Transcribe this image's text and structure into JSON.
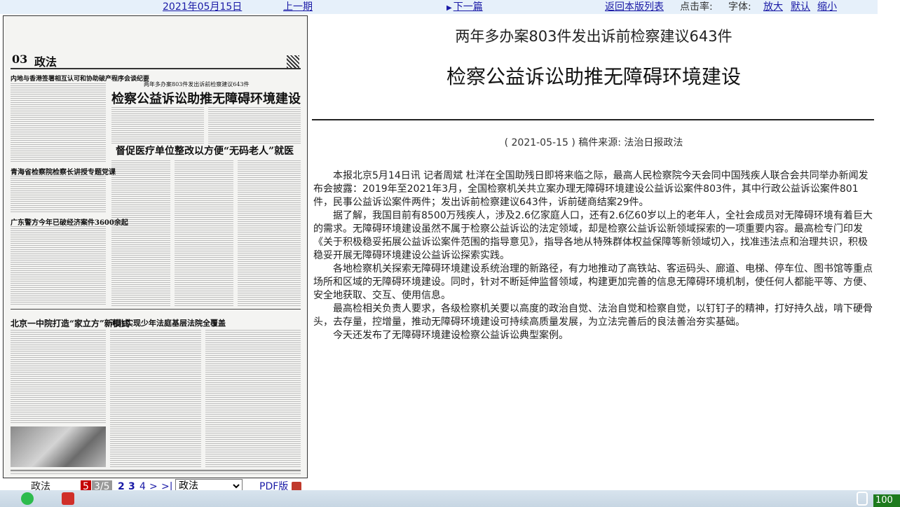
{
  "topbar": {
    "date": "2021年05月15日",
    "prev": "上一期",
    "next": "下一篇",
    "back": "返回本版列表",
    "clicks_label": "点击率:",
    "font_label": "字体:",
    "font_large": "放大",
    "font_default": "默认",
    "font_small": "缩小"
  },
  "paper": {
    "page_no": "03",
    "section": "政法",
    "headlines": [
      "两年多办案803件发出诉前检察建议643件",
      "检察公益诉讼助推无障碍环境建设",
      "督促医疗单位整改以方便“无码老人”就医",
      "内地与香港签署相互认可和协助破产程序会谈纪要",
      "青海省检察院检察长讲授专题党课",
      "广东警方今年已破经济案件3600余起",
      "北京一中院打造“家立方”新模式",
      "河北实现少年法庭基层法院全覆盖"
    ]
  },
  "article": {
    "subtitle": "两年多办案803件发出诉前检察建议643件",
    "title": "检察公益诉讼助推无障碍环境建设",
    "meta": "( 2021-05-15 )  稿件来源:  法治日报政法",
    "paragraphs": [
      "本报北京5月14日讯 记者周斌 杜洋在全国助残日即将来临之际，最高人民检察院今天会同中国残疾人联合会共同举办新闻发布会披露：2019年至2021年3月，全国检察机关共立案办理无障碍环境建设公益诉讼案件803件，其中行政公益诉讼案件801件，民事公益诉讼案件两件；发出诉前检察建议643件，诉前磋商结案29件。",
      "据了解，我国目前有8500万残疾人，涉及2.6亿家庭人口，还有2.6亿60岁以上的老年人，全社会成员对无障碍环境有着巨大的需求。无障碍环境建设虽然不属于检察公益诉讼的法定领域，却是检察公益诉讼新领域探索的一项重要内容。最高检专门印发《关于积极稳妥拓展公益诉讼案件范围的指导意见》，指导各地从特殊群体权益保障等新领域切入，找准违法点和治理共识，积极稳妥开展无障碍环境建设公益诉讼探索实践。",
      "各地检察机关探索无障碍环境建设系统治理的新路径，有力地推动了高铁站、客运码头、廊道、电梯、停车位、图书馆等重点场所和区域的无障碍环境建设。同时，针对不断延伸监督领域，构建更加完善的信息无障碍环境机制，使任何人都能平等、方便、安全地获取、交互、使用信息。",
      "最高检相关负责人要求，各级检察机关要以高度的政治自觉、法治自觉和检察自觉，以钉钉子的精神，打好持久战，啃下硬骨头，去存量，控增量，推动无障碍环境建设可持续高质量发展，为立法完善后的良法善治夯实基础。",
      "今天还发布了无障碍环境建设检察公益诉讼典型案例。"
    ]
  },
  "pager": {
    "section": "政法",
    "current": "5",
    "total": "3/5",
    "p2": "2",
    "p3": "3",
    "p4": "4",
    "next": ">",
    "last": ">|",
    "select_value": "政法",
    "pdf": "PDF版"
  },
  "taskbar": {
    "zoom": "100"
  }
}
